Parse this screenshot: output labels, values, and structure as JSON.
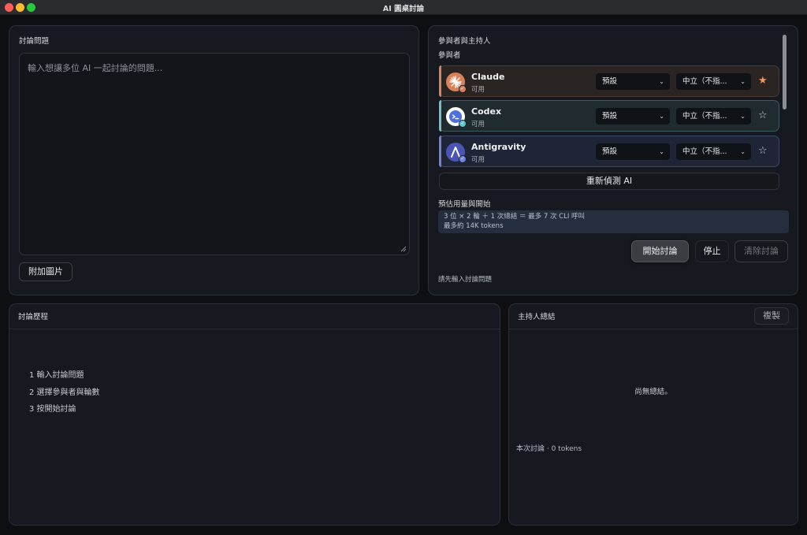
{
  "window": {
    "title": "AI 圓桌討論"
  },
  "question": {
    "title": "討論問題",
    "placeholder": "輸入想讓多位 AI 一起討論的問題...",
    "attach_label": "附加圖片"
  },
  "participants": {
    "title": "參與者與主持人",
    "subtitle": "參與者",
    "items": [
      {
        "name": "Claude",
        "status": "可用",
        "model": "預設",
        "stance": "中立（不指...",
        "moderator": true,
        "accent": "#d9825a",
        "icon": "claude-logo-icon"
      },
      {
        "name": "Codex",
        "status": "可用",
        "model": "預設",
        "stance": "中立（不指...",
        "moderator": false,
        "accent": "#6fc3c8",
        "icon": "codex-logo-icon"
      },
      {
        "name": "Antigravity",
        "status": "可用",
        "model": "預設",
        "stance": "中立（不指...",
        "moderator": false,
        "accent": "#6f84d8",
        "icon": "antigravity-logo-icon"
      }
    ],
    "redetect_label": "重新偵測 AI",
    "estimate_title": "預估用量與開始",
    "estimate_line1": "3 位 × 2 輪 ＋ 1 次總結 ＝ 最多 7 次 CLI 呼叫",
    "estimate_line2": "最多約 14K tokens",
    "start_label": "開始討論",
    "stop_label": "停止",
    "clear_label": "清除討論",
    "hint": "請先輸入討論問題"
  },
  "history": {
    "title": "討論歷程",
    "steps": [
      "1 輸入討論問題",
      "2 選擇參與者與輪數",
      "3 按開始討論"
    ]
  },
  "summary": {
    "title": "主持人總結",
    "copy_label": "複製",
    "empty_text": "尚無總結。",
    "token_line": "本次討論 · 0 tokens"
  },
  "colors": {
    "star_active": "#f0955d",
    "panel_bg": "#161a20",
    "estimate_bg": "#252e3f"
  }
}
